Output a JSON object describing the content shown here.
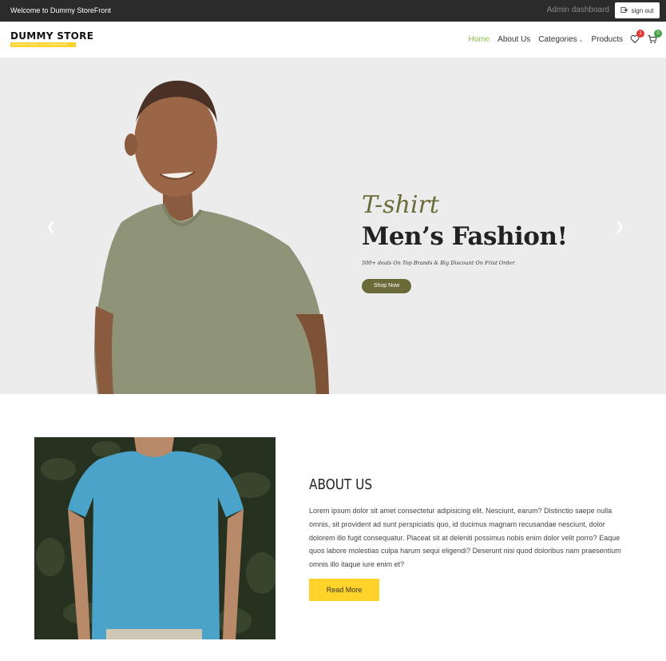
{
  "topbar": {
    "welcome": "Welcome to Dummy StoreFront",
    "admin_link": "Admin dashboard",
    "signout_label": "sign out"
  },
  "header": {
    "logo_name": "DUMMY STORE",
    "logo_tagline": "A SIMPLE FREE TO STOREFRONT",
    "nav": [
      {
        "label": "Home",
        "active": true
      },
      {
        "label": "About Us",
        "active": false
      },
      {
        "label": "Categories",
        "active": false
      },
      {
        "label": "Products",
        "active": false
      }
    ],
    "wishlist_count": "1",
    "cart_count": "0",
    "colors": {
      "active_nav": "#8bc34a",
      "wishlist_badge": "#e53935",
      "cart_badge": "#43a047"
    }
  },
  "hero": {
    "script_text": "T-shirt",
    "title": "Men’s Fashion!",
    "subtitle": "500+ deals On Top Brands & Big Discount On Frist Order",
    "button_label": "Shop Now",
    "prev_icon": "chevron-left-icon",
    "next_icon": "chevron-right-icon",
    "colors": {
      "accent": "#6b6b3a",
      "background": "#ececec"
    }
  },
  "about": {
    "title": "ABOUT US",
    "body": "Lorem ipsum dolor sit amet consectetur adipisicing elit. Nesciunt, earum? Distinctio saepe nulla omnis, sit provident ad sunt perspiciatis quo, id ducimus magnam recusandae nesciunt, dolor dolorem illo fugit consequatur. Placeat sit at deleniti possimus nobis enim dolor velit porro? Eaque quos labore molestias culpa harum sequi eligendi? Deserunt nisi quod doloribus nam praesentium omnis illo itaque iure enim et?",
    "button_label": "Read More",
    "colors": {
      "button": "#ffd32a"
    }
  }
}
